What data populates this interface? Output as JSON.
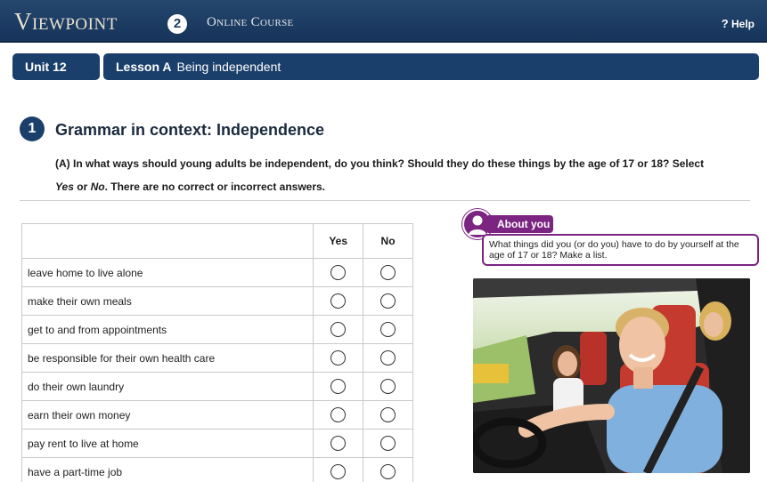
{
  "header": {
    "brand": "Viewpoint",
    "level": "2",
    "subtitle": "Online Course",
    "help_label": "Help",
    "help_icon": "?"
  },
  "nav": {
    "unit": "Unit 12",
    "lesson_prefix": "Lesson A",
    "lesson_title": "Being independent"
  },
  "section": {
    "number": "1",
    "title": "Grammar in context: Independence",
    "instructions_part1": "(A) In what ways should young adults be independent, do you think? Should they do these things by the age of 17 or 18? Select",
    "instructions_yes": "Yes",
    "instructions_or": " or ",
    "instructions_no": "No",
    "instructions_part2": ". There are no correct or incorrect answers."
  },
  "table": {
    "headers": {
      "statement": "",
      "yes": "Yes",
      "no": "No"
    },
    "rows": [
      "leave home to live alone",
      "make their own meals",
      "get to and from appointments",
      "be responsible for their own health care",
      "do their own laundry",
      "earn their own money",
      "pay rent to live at home",
      "have a part-time job"
    ]
  },
  "about_you": {
    "label": "About you",
    "prompt": "What things did you (or do you) have to do by yourself at the age of 17 or 18? Make a list."
  },
  "colors": {
    "header_bg": "#1b3f6b",
    "accent_purple": "#7b2482"
  }
}
